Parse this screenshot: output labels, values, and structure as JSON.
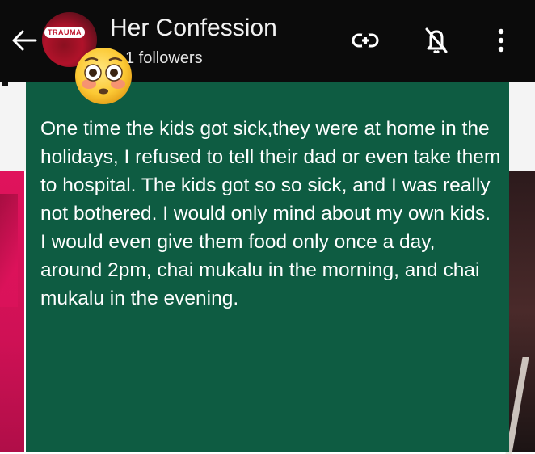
{
  "header": {
    "title": "Her Confession",
    "followers": "1 followers",
    "avatar_tag": "TRAUMA",
    "icons": [
      "back-arrow-icon",
      "link-icon",
      "notifications-off-icon",
      "more-vert-icon"
    ]
  },
  "message": {
    "text": "One time the kids got sick,they were at home in the holidays, I refused to tell their dad or even take them to hospital. The kids got so so sick, and I was really not bothered. I would only mind about my own kids. I would even give them food only once a day, around 2pm, chai mukalu in the morning, and chai mukalu in the evening."
  },
  "emoji": "flushed-face-emoji",
  "colors": {
    "header_bg": "#0b0b0b",
    "panel_bg": "#0e5c42",
    "left_accent": "#e0135c"
  }
}
